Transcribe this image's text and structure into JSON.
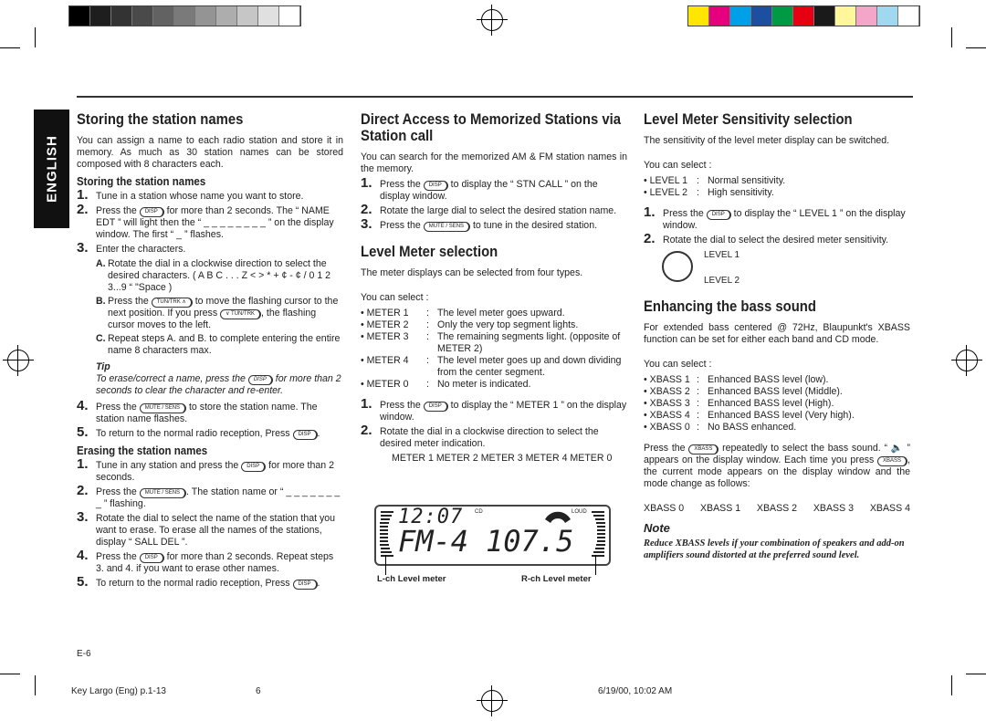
{
  "color_bars": {
    "left": [
      "#000000",
      "#1e1e1e",
      "#333333",
      "#4a4a4a",
      "#626262",
      "#7a7a7a",
      "#949494",
      "#adadad",
      "#c6c6c6",
      "#e0e0e0",
      "#ffffff"
    ],
    "right": [
      "#ffe600",
      "#e6007e",
      "#00a0e9",
      "#1d4fa0",
      "#009944",
      "#e60012",
      "#1a1a1a",
      "#fff799",
      "#f4a6c8",
      "#a0d8ef",
      "#ffffff"
    ]
  },
  "side_tab": "ENGLISH",
  "col1": [
    {
      "t": "h1",
      "s": [
        "Storing the station names"
      ]
    },
    {
      "t": "p",
      "s": [
        "You can assign a name to each radio station and store it in memory. As much as 30 station names can be stored composed with 8 characters each."
      ]
    },
    {
      "t": "h2",
      "s": [
        "Storing the station names"
      ]
    },
    {
      "t": "step",
      "n": "1.",
      "s": [
        "Tune in a station whose name you want to store."
      ]
    },
    {
      "t": "step",
      "n": "2.",
      "s": [
        "Press the ",
        {
          "b": "DISP"
        },
        " for more than 2 seconds. The “ NAME EDT ” will light then the “ _ _ _ _ _ _ _ _ ” on the display window. The first “ _ ” flashes."
      ]
    },
    {
      "t": "step",
      "n": "3.",
      "s": [
        "Enter the characters."
      ]
    },
    {
      "t": "sub",
      "n": "A.",
      "s": [
        "Rotate the dial in a clockwise direction to select the desired characters. ( A   B   C   . . . Z   <   >   *   +   ¢   -   ¢   /   0   1   2   3...9  “ \"Space )"
      ]
    },
    {
      "t": "sub",
      "n": "B.",
      "s": [
        "Press the ",
        {
          "b": "TUN/TRK ∧"
        },
        " to move the flashing cursor to the next position. If you press ",
        {
          "b": "∨ TUN/TRK"
        },
        ", the flashing cursor moves to the left."
      ]
    },
    {
      "t": "sub",
      "n": "C.",
      "s": [
        "Repeat steps A. and B. to complete entering the entire name 8 characters max."
      ]
    },
    {
      "t": "tip",
      "h": "Tip",
      "s": [
        "To erase/correct a name, press the ",
        {
          "b": "DISP"
        },
        " for more than 2 seconds to clear the character and re-enter."
      ]
    },
    {
      "t": "step",
      "n": "4.",
      "s": [
        "Press the ",
        {
          "b": "MUTE / SENS"
        },
        " to store the station name. The station name flashes."
      ]
    },
    {
      "t": "step",
      "n": "5.",
      "s": [
        "To return to the normal radio reception, Press ",
        {
          "b": "DISP"
        },
        "."
      ]
    },
    {
      "t": "h2",
      "s": [
        "Erasing the station names"
      ]
    },
    {
      "t": "step",
      "n": "1.",
      "s": [
        "Tune in any station and press the ",
        {
          "b": "DISP"
        },
        " for more than 2 seconds."
      ]
    },
    {
      "t": "step",
      "n": "2.",
      "s": [
        "Press the ",
        {
          "b": "MUTE / SENS"
        },
        ". The station name or “ _ _ _ _ _ _ _ _ ” flashing."
      ]
    },
    {
      "t": "step",
      "n": "3.",
      "s": [
        "Rotate the dial to select the name of the station that you want to erase. To erase all the names of the stations, display “ SALL DEL ”."
      ]
    },
    {
      "t": "step",
      "n": "4.",
      "s": [
        "Press the ",
        {
          "b": "DISP"
        },
        " for more than 2 seconds. Repeat steps 3. and 4. if you want to erase other names."
      ]
    },
    {
      "t": "step",
      "n": "5.",
      "s": [
        "To return to the normal radio reception, Press ",
        {
          "b": "DISP"
        },
        "."
      ]
    }
  ],
  "col2": [
    {
      "t": "h1",
      "s": [
        "Direct Access to Memorized Stations via Station call"
      ]
    },
    {
      "t": "p",
      "s": [
        "You can search for the memorized AM & FM station names in the memory."
      ]
    },
    {
      "t": "step",
      "n": "1.",
      "s": [
        "Press the ",
        {
          "b": "DISP"
        },
        " to display the “ STN CALL ” on the display window."
      ]
    },
    {
      "t": "step",
      "n": "2.",
      "s": [
        "Rotate the large dial to select the desired station name."
      ]
    },
    {
      "t": "step",
      "n": "3.",
      "s": [
        "Press the ",
        {
          "b": "MUTE / SENS"
        },
        " to tune in the desired station."
      ]
    },
    {
      "t": "gap"
    },
    {
      "t": "h1",
      "s": [
        "Level Meter selection"
      ]
    },
    {
      "t": "p",
      "s": [
        "The meter displays can be selected from four types."
      ]
    },
    {
      "t": "gap"
    },
    {
      "t": "p",
      "s": [
        "You can select :"
      ]
    },
    {
      "t": "bul",
      "k": "• METER 1",
      "v": "The level meter goes upward."
    },
    {
      "t": "bul",
      "k": "• METER 2",
      "v": "Only the very top segment lights."
    },
    {
      "t": "bul",
      "k": "• METER 3",
      "v": "The remaining segments light. (opposite of METER 2)"
    },
    {
      "t": "bul",
      "k": "• METER 4",
      "v": "The level meter goes up and down dividing from the center segment."
    },
    {
      "t": "bul",
      "k": "• METER 0",
      "v": "No meter is indicated."
    },
    {
      "t": "gap"
    },
    {
      "t": "step",
      "n": "1.",
      "s": [
        "Press the ",
        {
          "b": "DISP"
        },
        " to display the “ METER 1 ” on the display window."
      ]
    },
    {
      "t": "step",
      "n": "2.",
      "s": [
        "Rotate the dial in a clockwise direction to select the desired meter indication."
      ]
    },
    {
      "t": "sub",
      "n": "",
      "s": [
        "METER 1     METER 2     METER 3     METER 4     METER 0"
      ]
    }
  ],
  "lcd": {
    "time": "12:07",
    "band": "FM-4",
    "freq": "107.5",
    "cd": "CD",
    "loud": "LOUD",
    "left_label": "L-ch Level meter",
    "right_label": "R-ch Level meter"
  },
  "col3": [
    {
      "t": "h1",
      "s": [
        "Level Meter Sensitivity selection"
      ]
    },
    {
      "t": "p",
      "s": [
        "The sensitivity of the level meter display can be switched."
      ]
    },
    {
      "t": "gap"
    },
    {
      "t": "p",
      "s": [
        "You can select :"
      ]
    },
    {
      "t": "bul2",
      "k": "• LEVEL 1",
      "v": "Normal sensitivity."
    },
    {
      "t": "bul2",
      "k": "• LEVEL 2",
      "v": "High sensitivity."
    },
    {
      "t": "gap"
    },
    {
      "t": "step",
      "n": "1.",
      "s": [
        "Press the ",
        {
          "b": "DISP"
        },
        " to display the “ LEVEL 1 ” on the display window."
      ]
    },
    {
      "t": "step",
      "n": "2.",
      "s": [
        "Rotate the dial to select the desired meter sensitivity."
      ]
    },
    {
      "t": "dial",
      "a": "LEVEL 1",
      "b": "LEVEL 2"
    },
    {
      "t": "h1",
      "s": [
        "Enhancing the bass sound"
      ]
    },
    {
      "t": "p",
      "s": [
        "For extended bass centered @ 72Hz, Blaupunkt's XBASS function can be set for either each band and CD mode."
      ]
    },
    {
      "t": "gap"
    },
    {
      "t": "p",
      "s": [
        "You can select :"
      ]
    },
    {
      "t": "bul2",
      "k": "• XBASS 1",
      "v": "Enhanced BASS level (low)."
    },
    {
      "t": "bul2",
      "k": "• XBASS 2",
      "v": "Enhanced BASS level (Middle)."
    },
    {
      "t": "bul2",
      "k": "• XBASS 3",
      "v": "Enhanced BASS level (High)."
    },
    {
      "t": "bul2",
      "k": "• XBASS 4",
      "v": "Enhanced BASS level (Very high)."
    },
    {
      "t": "bul2",
      "k": "• XBASS 0",
      "v": "No BASS enhanced."
    },
    {
      "t": "gap"
    },
    {
      "t": "p",
      "s": [
        "Press the ",
        {
          "b": "XBASS"
        },
        " repeatedly to select the bass sound. “ 🔈 ” appears on the display window. Each time you press ",
        {
          "b": "XBASS"
        },
        ", the current mode appears on the display window and the mode change as follows:"
      ]
    },
    {
      "t": "gap"
    },
    {
      "t": "seq",
      "items": [
        "XBASS 0",
        "XBASS 1",
        "XBASS 2",
        "XBASS 3",
        "XBASS 4"
      ]
    },
    {
      "t": "noteh",
      "s": [
        "Note"
      ]
    },
    {
      "t": "note",
      "s": [
        "Reduce XBASS levels if your combination of speakers and add-on amplifiers sound distorted at the preferred sound level."
      ]
    }
  ],
  "footer": {
    "page_label": "E-6",
    "doc_name": "Key Largo (Eng) p.1-13",
    "page_num": "6",
    "timestamp": "6/19/00, 10:02 AM"
  }
}
